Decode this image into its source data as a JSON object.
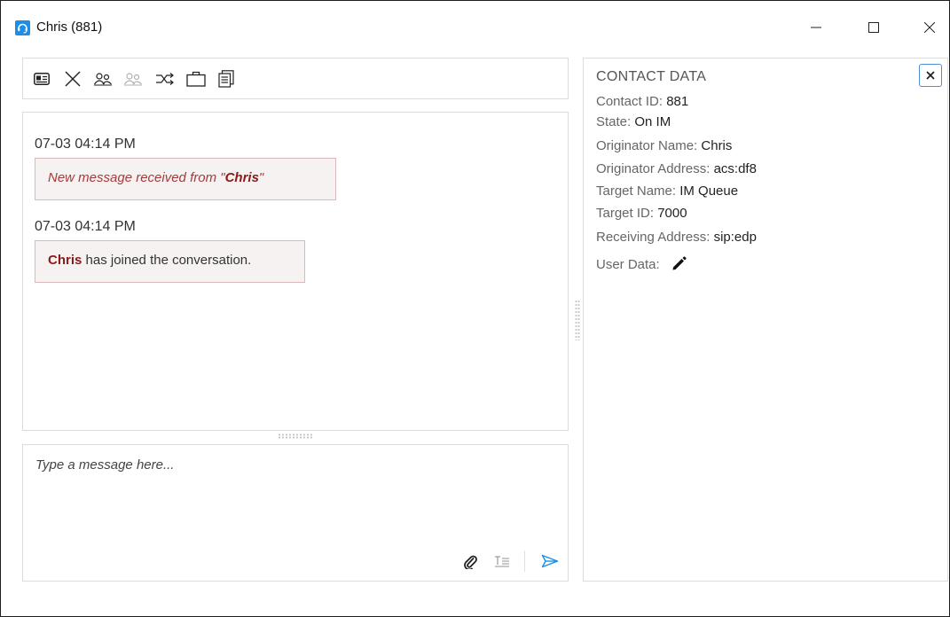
{
  "window": {
    "title": "Chris (881)",
    "app_icon": "headset-icon",
    "controls": [
      "minimize-icon",
      "maximize-icon",
      "close-icon"
    ]
  },
  "toolbar": {
    "icons": [
      "contact-card-icon",
      "end-chat-icon",
      "transfer-icon",
      "conference-icon",
      "route-icon",
      "briefcase-icon",
      "copy-icon"
    ]
  },
  "transcript": {
    "entries": [
      {
        "timestamp": "07-03 04:14 PM",
        "prefix": "New message received from \"",
        "name": "Chris",
        "suffix": "\""
      },
      {
        "timestamp": "07-03 04:14 PM",
        "name": "Chris",
        "text": " has joined the conversation."
      }
    ]
  },
  "composer": {
    "placeholder": "Type a message here...",
    "icons": [
      "attach-icon",
      "text-format-icon",
      "send-icon"
    ]
  },
  "contact_data": {
    "title": "CONTACT DATA",
    "fields": [
      {
        "label": "Contact ID:",
        "value": "881"
      },
      {
        "label": "State:",
        "value": "On IM"
      },
      {
        "label": "Originator Name:",
        "value": "Chris"
      },
      {
        "label": "Originator Address:",
        "value": "acs:df8"
      },
      {
        "label": "Target Name:",
        "value": "IM Queue"
      },
      {
        "label": "Target ID:",
        "value": "7000"
      },
      {
        "label": "Receiving Address:",
        "value": "sip:edp"
      }
    ],
    "user_data_label": "User Data:"
  },
  "colors": {
    "accent": "#1a8ee8",
    "name_highlight": "#8b1a1a",
    "notice_text": "#a33b3b",
    "message_bg": "#f7f2f2",
    "close_border": "#4a90d9"
  }
}
